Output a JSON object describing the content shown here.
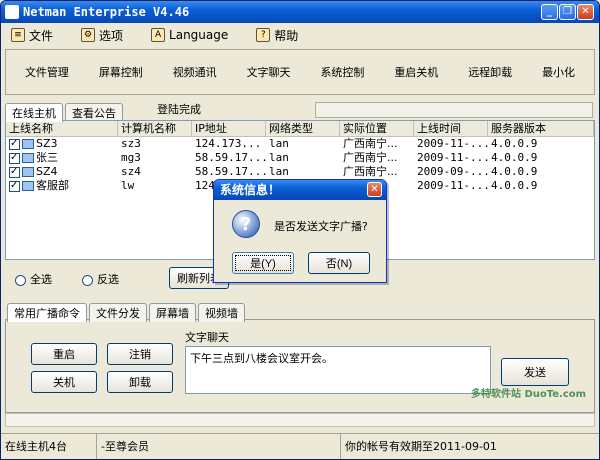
{
  "window": {
    "title": "Netman Enterprise V4.46"
  },
  "menu": [
    {
      "label": "文件",
      "icon": "file-icon"
    },
    {
      "label": "选项",
      "icon": "options-icon"
    },
    {
      "label": "Language",
      "icon": "language-icon"
    },
    {
      "label": "帮助",
      "icon": "help-icon"
    }
  ],
  "toolbar": [
    "文件管理",
    "屏幕控制",
    "视频通讯",
    "文字聊天",
    "系统控制",
    "重启关机",
    "远程卸载",
    "最小化"
  ],
  "top_tabs": [
    "在线主机",
    "查看公告"
  ],
  "login_status": "登陆完成",
  "table": {
    "columns": [
      "上线名称",
      "计算机名称",
      "IP地址",
      "网络类型",
      "实际位置",
      "上线时间",
      "服务器版本"
    ],
    "rows": [
      [
        "SZ3",
        "sz3",
        "124.173...",
        "lan",
        "广西南宁...",
        "2009-11-...",
        "4.0.0.9"
      ],
      [
        "张三",
        "mg3",
        "58.59.17...",
        "lan",
        "广西南宁...",
        "2009-11-...",
        "4.0.0.9"
      ],
      [
        "SZ4",
        "sz4",
        "58.59.17...",
        "lan",
        "广西南宁...",
        "2009-09-...",
        "4.0.0.9"
      ],
      [
        "客服部",
        "lw",
        "124...",
        "",
        "",
        "2009-11-...",
        "4.0.0.9"
      ]
    ]
  },
  "select_all": "全选",
  "invert": "反选",
  "refresh": "刷新列表",
  "bottom_tabs": [
    "常用广播命令",
    "文件分发",
    "屏幕墙",
    "视频墙"
  ],
  "commands": {
    "restart": "重启",
    "logout": "注销",
    "shutdown": "关机",
    "uninstall": "卸载"
  },
  "chat": {
    "label": "文字聊天",
    "text": "下午三点到八楼会议室开会。",
    "send": "发送"
  },
  "status": {
    "online": "在线主机4台",
    "member": "-至尊会员",
    "expiry": "你的帐号有效期至2011-09-01"
  },
  "dialog": {
    "title": "系统信息！",
    "message": "是否发送文字广播?",
    "yes": "是(Y)",
    "no": "否(N)"
  },
  "watermark": "多特软件站 DuoTe.com"
}
